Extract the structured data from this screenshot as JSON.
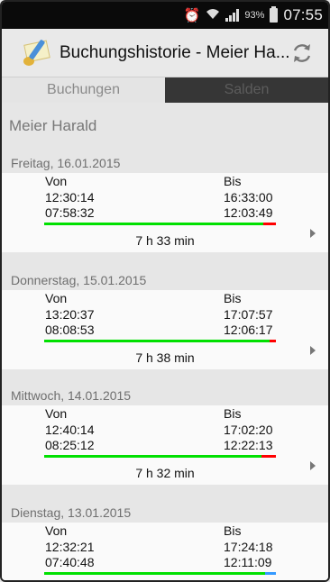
{
  "status_bar": {
    "battery_percent": "93%",
    "time": "07:55"
  },
  "action_bar": {
    "title": "Buchungshistorie - Meier Ha..."
  },
  "tabs": [
    {
      "label": "Buchungen",
      "active": true
    },
    {
      "label": "Salden",
      "active": false
    }
  ],
  "person": "Meier Harald",
  "columns": {
    "from": "Von",
    "to": "Bis"
  },
  "days": [
    {
      "date": "Freitag, 16.01.2015",
      "rows": [
        [
          "12:30:14",
          "16:33:00"
        ],
        [
          "07:58:32",
          "12:03:49"
        ]
      ],
      "duration": "7 h 33 min",
      "bar": {
        "green": 0.9,
        "end_color": "#ff0000"
      }
    },
    {
      "date": "Donnerstag, 15.01.2015",
      "rows": [
        [
          "13:20:37",
          "17:07:57"
        ],
        [
          "08:08:53",
          "12:06:17"
        ]
      ],
      "duration": "7 h 38 min",
      "bar": {
        "green": 0.92,
        "end_color": "#ff0000"
      }
    },
    {
      "date": "Mittwoch, 14.01.2015",
      "rows": [
        [
          "12:40:14",
          "17:02:20"
        ],
        [
          "08:25:12",
          "12:22:13"
        ]
      ],
      "duration": "7 h 32 min",
      "bar": {
        "green": 0.92,
        "end_color": "#ff0000"
      }
    },
    {
      "date": "Dienstag, 13.01.2015",
      "rows": [
        [
          "12:32:21",
          "17:24:18"
        ],
        [
          "07:40:48",
          "12:11:09"
        ]
      ],
      "duration": "",
      "bar": {
        "green": 0.92,
        "end_color": "#3399ff"
      }
    }
  ],
  "colors": {
    "green_bar": "#00e000",
    "red_bar": "#ff0000",
    "blue_bar": "#3399ff"
  }
}
